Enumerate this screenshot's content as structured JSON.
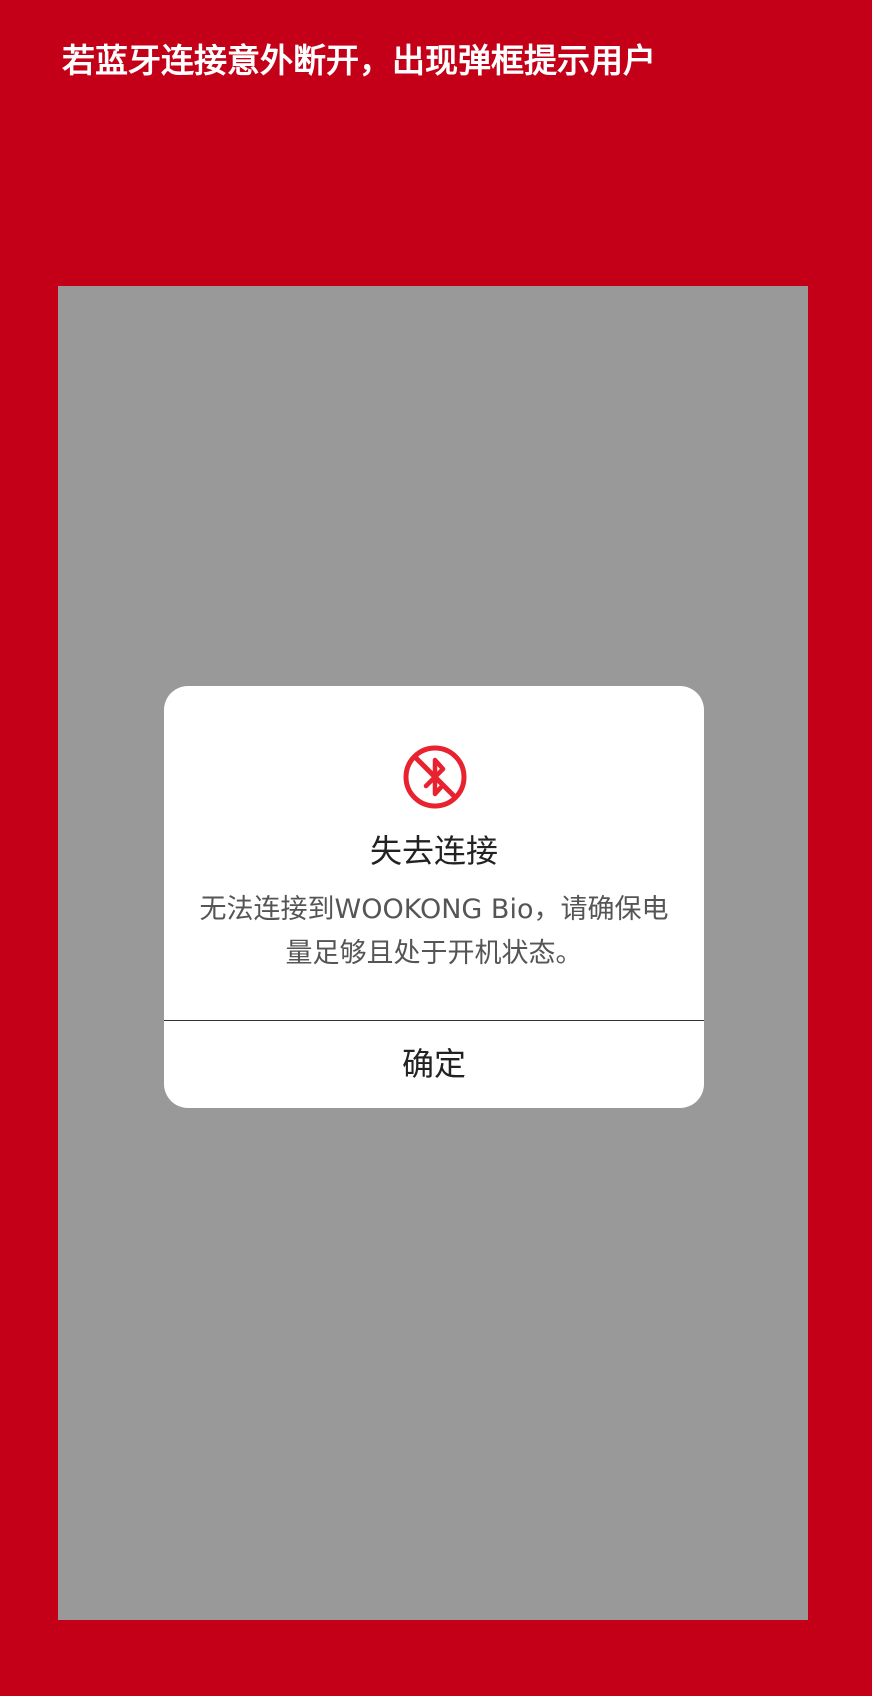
{
  "page": {
    "heading": "若蓝牙连接意外断开，出现弹框提示用户"
  },
  "dialog": {
    "icon": "bluetooth-disabled-icon",
    "title": "失去连接",
    "message": "无法连接到WOOKONG Bio，请确保电量足够且处于开机状态。",
    "confirm_label": "确定"
  },
  "colors": {
    "background": "#c40018",
    "overlay": "#999999",
    "dialog": "#ffffff",
    "icon": "#e8222f"
  }
}
